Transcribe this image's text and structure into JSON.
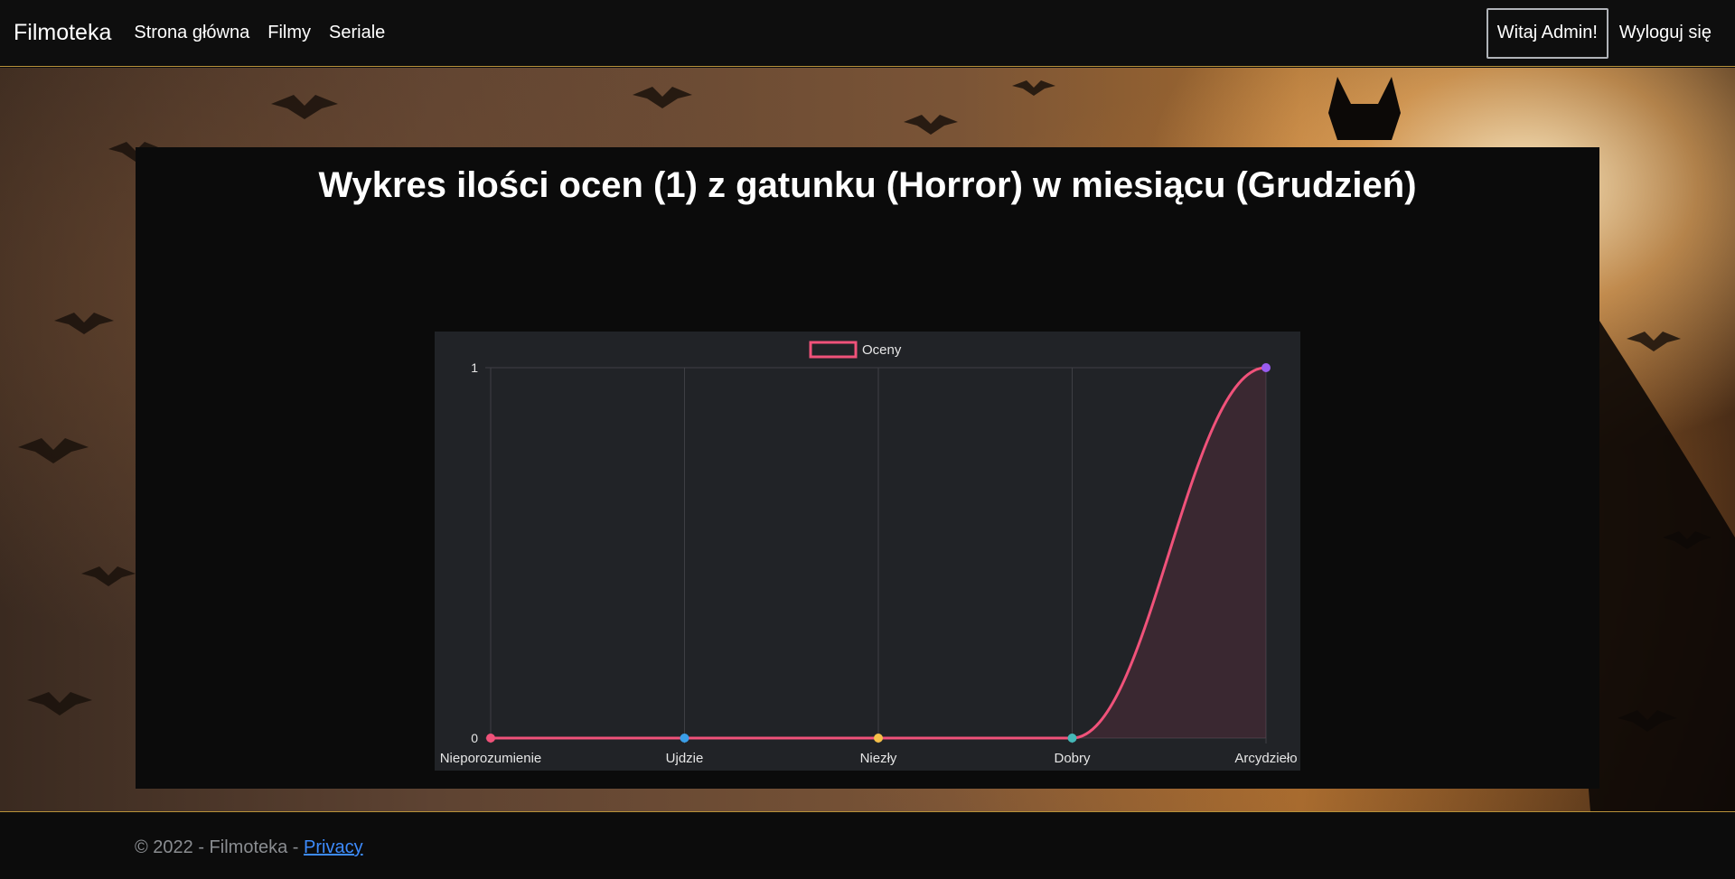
{
  "navbar": {
    "brand": "Filmoteka",
    "links": [
      "Strona główna",
      "Filmy",
      "Seriale"
    ],
    "welcome": "Witaj Admin!",
    "logout": "Wyloguj się"
  },
  "page": {
    "title": "Wykres ilości ocen (1) z gatunku (Horror) w miesiącu (Grudzień)"
  },
  "chart_data": {
    "type": "line",
    "categories": [
      "Nieporozumienie",
      "Ujdzie",
      "Niezły",
      "Dobry",
      "Arcydzieło"
    ],
    "series": [
      {
        "name": "Oceny",
        "values": [
          0,
          0,
          0,
          0,
          1
        ],
        "line_color": "#f0527a",
        "fill": true,
        "point_colors": [
          "#f0527a",
          "#3a9ee8",
          "#f5c04a",
          "#45b8b8",
          "#9a5cf0"
        ]
      }
    ],
    "yticks": [
      0,
      1
    ],
    "ylim": [
      0,
      1
    ],
    "legend": "top",
    "grid": true
  },
  "footer": {
    "text": "© 2022 - Filmoteka - ",
    "link": "Privacy"
  },
  "colors": {
    "accent_border": "#b8923a",
    "link": "#3d8bfd",
    "chart_bg": "#212327"
  }
}
